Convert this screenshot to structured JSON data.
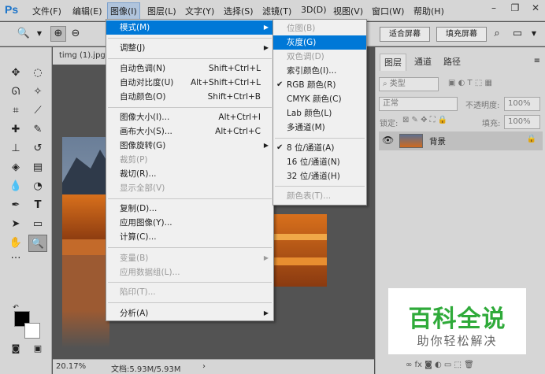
{
  "app": {
    "logo": "Ps"
  },
  "menubar": {
    "items": [
      "文件(F)",
      "编辑(E)",
      "图像(I)",
      "图层(L)",
      "文字(Y)",
      "选择(S)",
      "滤镜(T)",
      "3D(D)",
      "视图(V)",
      "窗口(W)",
      "帮助(H)"
    ],
    "active": "图像(I)"
  },
  "options": {
    "fit_screen": "适合屏幕",
    "fill_screen": "填充屏幕"
  },
  "document": {
    "tab": "timg (1).jpg",
    "zoom": "20.17%",
    "doc_info": "文档:5.93M/5.93M"
  },
  "image_menu": {
    "items": [
      {
        "label": "模式(M)",
        "submenu": true,
        "highlighted": true
      },
      {
        "label": "调整(J)",
        "submenu": true
      },
      {
        "label": "自动色调(N)",
        "shortcut": "Shift+Ctrl+L"
      },
      {
        "label": "自动对比度(U)",
        "shortcut": "Alt+Shift+Ctrl+L"
      },
      {
        "label": "自动颜色(O)",
        "shortcut": "Shift+Ctrl+B"
      },
      {
        "label": "图像大小(I)...",
        "shortcut": "Alt+Ctrl+I"
      },
      {
        "label": "画布大小(S)...",
        "shortcut": "Alt+Ctrl+C"
      },
      {
        "label": "图像旋转(G)",
        "submenu": true
      },
      {
        "label": "裁剪(P)",
        "disabled": true
      },
      {
        "label": "裁切(R)..."
      },
      {
        "label": "显示全部(V)",
        "disabled": true
      },
      {
        "label": "复制(D)..."
      },
      {
        "label": "应用图像(Y)..."
      },
      {
        "label": "计算(C)..."
      },
      {
        "label": "变量(B)",
        "submenu": true,
        "disabled": true
      },
      {
        "label": "应用数据组(L)...",
        "disabled": true
      },
      {
        "label": "陷印(T)...",
        "disabled": true
      },
      {
        "label": "分析(A)",
        "submenu": true
      }
    ]
  },
  "mode_menu": {
    "items": [
      {
        "label": "位图(B)",
        "disabled": true
      },
      {
        "label": "灰度(G)",
        "highlighted": true
      },
      {
        "label": "双色调(D)",
        "disabled": true
      },
      {
        "label": "索引颜色(I)..."
      },
      {
        "label": "RGB 颜色(R)",
        "checked": true
      },
      {
        "label": "CMYK 颜色(C)"
      },
      {
        "label": "Lab 颜色(L)"
      },
      {
        "label": "多通道(M)"
      },
      {
        "label": "8 位/通道(A)",
        "checked": true
      },
      {
        "label": "16 位/通道(N)"
      },
      {
        "label": "32 位/通道(H)"
      },
      {
        "label": "颜色表(T)...",
        "disabled": true
      }
    ]
  },
  "layers_panel": {
    "tabs": [
      "图层",
      "通道",
      "路径"
    ],
    "kind_filter": "类型",
    "blend_mode": "正常",
    "opacity_label": "不透明度:",
    "opacity_value": "100%",
    "lock_label": "锁定:",
    "fill_label": "填充:",
    "fill_value": "100%",
    "layer_name": "背景"
  },
  "watermark": {
    "title": "百科全说",
    "subtitle": "助你轻松解决"
  },
  "colors": {
    "menu_highlight": "#0078d7",
    "ui_gray": "#d6d6d6",
    "workspace": "#535353",
    "watermark_green": "#2faa3a"
  }
}
